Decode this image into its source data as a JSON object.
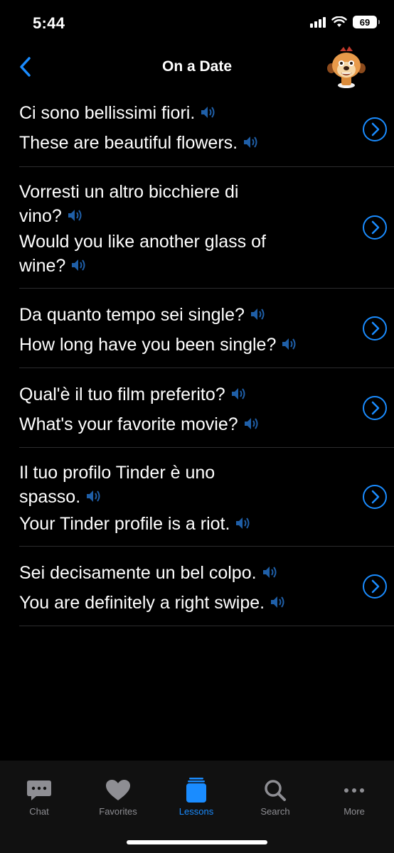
{
  "status_bar": {
    "time": "5:44",
    "battery": "69"
  },
  "nav": {
    "title": "On a Date"
  },
  "phrases": [
    {
      "italian": "Ci sono bellissimi fiori.",
      "english": "These are beautiful flowers."
    },
    {
      "italian": "Vorresti un altro bicchiere di vino?",
      "english": "Would you like another glass of wine?"
    },
    {
      "italian": "Da quanto tempo sei single?",
      "english": "How long have you been single?"
    },
    {
      "italian": "Qual'è il tuo film preferito?",
      "english": "What's your favorite movie?"
    },
    {
      "italian": "Il tuo profilo Tinder è uno spasso.",
      "english": "Your Tinder profile is a riot."
    },
    {
      "italian": "Sei decisamente un bel colpo.",
      "english": "You are definitely a right swipe."
    }
  ],
  "tabs": [
    {
      "label": "Chat",
      "icon": "chat-bubble-icon",
      "active": false
    },
    {
      "label": "Favorites",
      "icon": "heart-icon",
      "active": false
    },
    {
      "label": "Lessons",
      "icon": "lessons-icon",
      "active": true
    },
    {
      "label": "Search",
      "icon": "search-icon",
      "active": false
    },
    {
      "label": "More",
      "icon": "more-dots-icon",
      "active": false
    }
  ],
  "colors": {
    "accent": "#1a8cff",
    "speaker": "#1f5fa8",
    "inactive": "#8e8e93",
    "background": "#000000"
  }
}
